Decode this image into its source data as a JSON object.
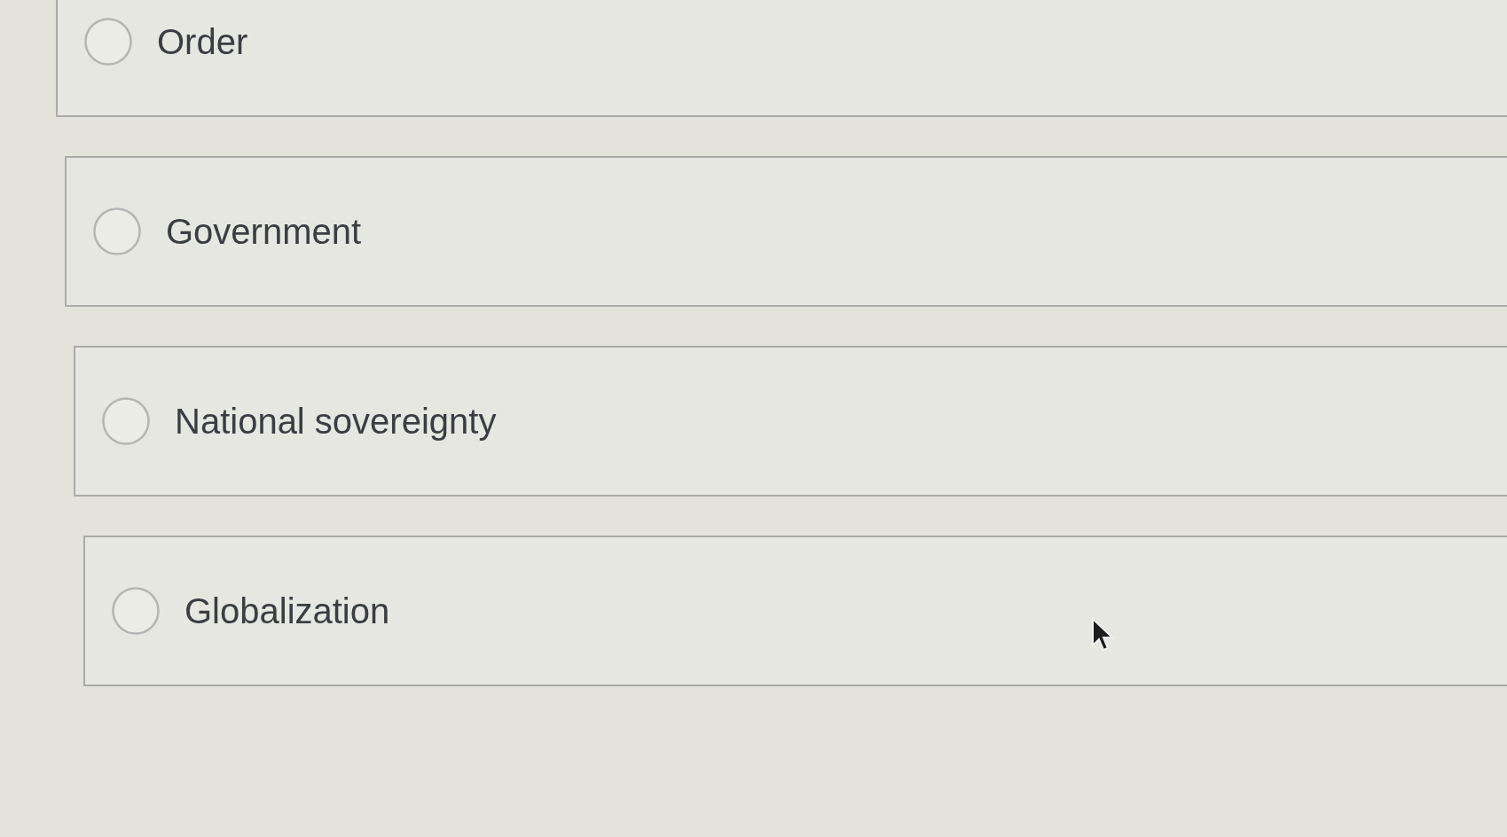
{
  "options": [
    {
      "label": "Order",
      "selected": false
    },
    {
      "label": "Government",
      "selected": false
    },
    {
      "label": "National sovereignty",
      "selected": false
    },
    {
      "label": "Globalization",
      "selected": false
    }
  ]
}
